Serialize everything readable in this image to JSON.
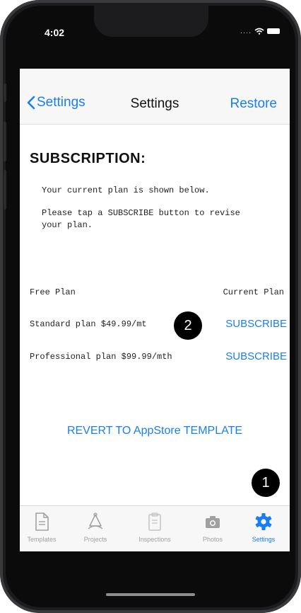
{
  "status_bar": {
    "time": "4:02",
    "signal": "...."
  },
  "navbar": {
    "back_label": "Settings",
    "title": "Settings",
    "action_label": "Restore"
  },
  "content": {
    "heading": "SUBSCRIPTION:",
    "intro_line1": "Your current plan is shown below.",
    "intro_line2": "Please tap a SUBSCRIBE button to revise your plan.",
    "plans": [
      {
        "name": "Free Plan",
        "status": "Current Plan"
      },
      {
        "name": "Standard plan $49.99/mt",
        "action": "SUBSCRIBE"
      },
      {
        "name": "Professional plan $99.99/mth",
        "action": "SUBSCRIBE"
      }
    ],
    "revert_label": "REVERT TO AppStore TEMPLATE"
  },
  "tabbar": {
    "tabs": [
      {
        "label": "Templates",
        "icon": "document-icon",
        "active": false
      },
      {
        "label": "Projects",
        "icon": "projects-icon",
        "active": false
      },
      {
        "label": "Inspections",
        "icon": "clipboard-icon",
        "active": false
      },
      {
        "label": "Photos",
        "icon": "camera-icon",
        "active": false
      },
      {
        "label": "Settings",
        "icon": "gear-icon",
        "active": true
      }
    ]
  },
  "annotations": {
    "badge1": "1",
    "badge2": "2"
  },
  "colors": {
    "accent": "#1a7ef3",
    "inactive": "#a0a0a0"
  }
}
